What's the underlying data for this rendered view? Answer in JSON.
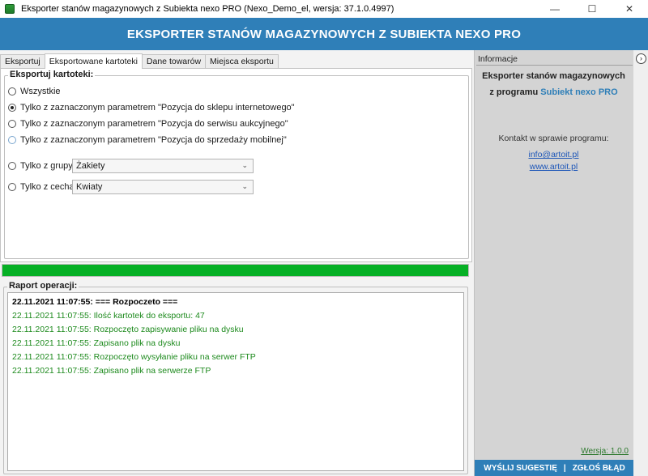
{
  "window": {
    "title": "Eksporter stanów magazynowych z Subiekta nexo PRO (Nexo_Demo_el, wersja: 37.1.0.4997)",
    "minimize": "—",
    "maximize": "☐",
    "close": "✕"
  },
  "header": {
    "title": "EKSPORTER STANÓW MAGAZYNOWYCH Z SUBIEKTA NEXO PRO"
  },
  "tabs": [
    {
      "label": "Eksportuj"
    },
    {
      "label": "Eksportowane kartoteki"
    },
    {
      "label": "Dane towarów"
    },
    {
      "label": "Miejsca eksportu"
    }
  ],
  "export_group": {
    "legend": "Eksportuj kartoteki:",
    "options": [
      {
        "label": "Wszystkie"
      },
      {
        "label": "Tylko z zaznaczonym parametrem \"Pozycja do sklepu internetowego\""
      },
      {
        "label": "Tylko z zaznaczonym parametrem \"Pozycja do serwisu aukcyjnego\""
      },
      {
        "label": "Tylko z zaznaczonym parametrem \"Pozycja do sprzedaży mobilnej\""
      }
    ],
    "group_filter": {
      "label": "Tylko z grupy:",
      "value": "Żakiety"
    },
    "feature_filter": {
      "label": "Tylko z cechą:",
      "value": "Kwiaty"
    }
  },
  "progress": {
    "fraction": 1.0
  },
  "report": {
    "legend": "Raport operacji:",
    "lines": [
      "22.11.2021 11:07:55: === Rozpoczeto ===",
      "22.11.2021 11:07:55: Ilość kartotek do eksportu: 47",
      "22.11.2021 11:07:55: Rozpoczęto zapisywanie pliku na dysku",
      "22.11.2021 11:07:55: Zapisano plik na dysku",
      "22.11.2021 11:07:55: Rozpoczęto wysyłanie pliku na serwer FTP",
      "22.11.2021 11:07:55: Zapisano plik na serwerze FTP"
    ]
  },
  "info_panel": {
    "heading": "Informacje",
    "line1": "Eksporter stanów magazynowych",
    "line2_prefix": "z programu ",
    "line2_accent": "Subiekt nexo PRO",
    "contact_label": "Kontakt w sprawie programu:",
    "email": "info@artoit.pl",
    "website": "www.artoit.pl",
    "version": "Wersja: 1.0.0",
    "suggest": "WYŚLIJ SUGESTIĘ",
    "separator": "|",
    "report_bug": "ZGŁOŚ BŁĄD",
    "collapse": "›"
  },
  "colors": {
    "header_blue": "#2f7fb8",
    "progress_green": "#06b025",
    "log_green": "#1d8a1d",
    "link_blue": "#1d56b8"
  }
}
